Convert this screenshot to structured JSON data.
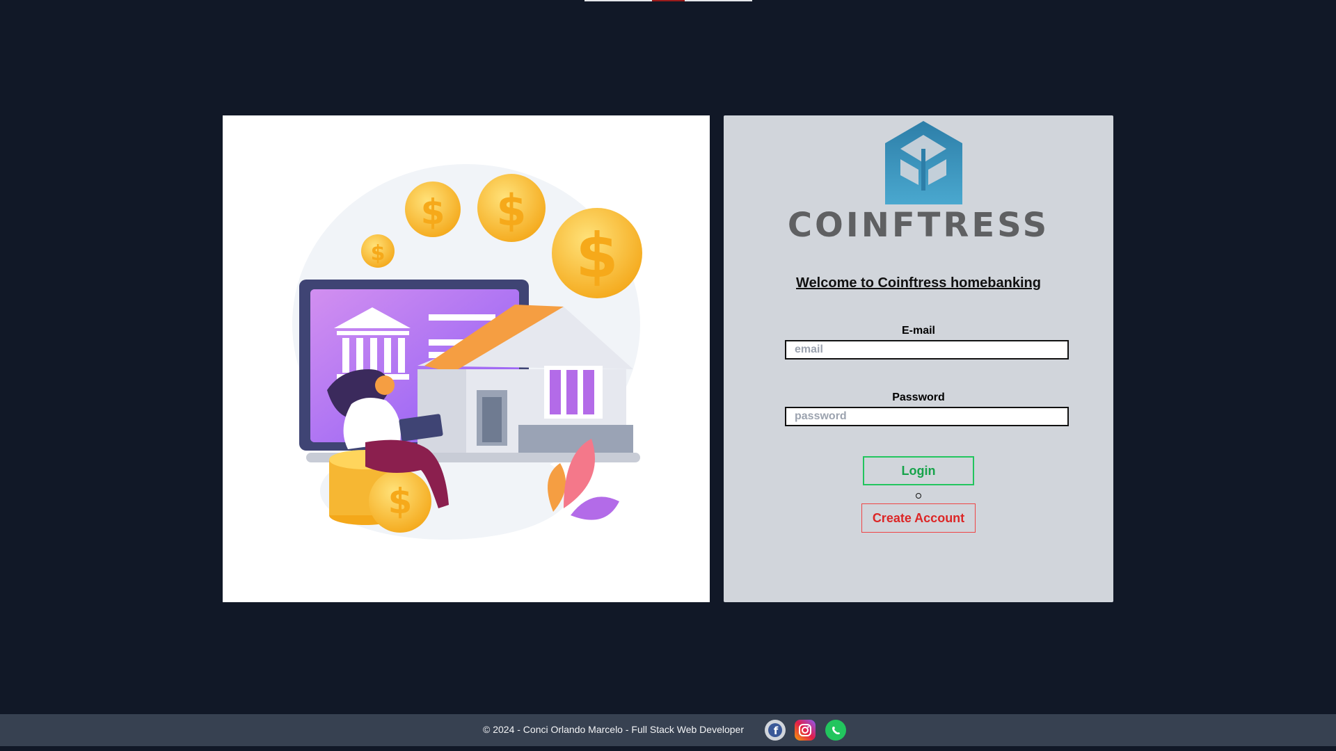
{
  "brand": {
    "logo_text": "COINFTRESS",
    "welcome": "Welcome to Coinftress homebanking"
  },
  "form": {
    "email_label": "E-mail",
    "email_placeholder": "email",
    "password_label": "Password",
    "password_placeholder": "password",
    "login_label": "Login",
    "create_account_label": "Create Account"
  },
  "footer": {
    "text": "© 2024 - Conci Orlando Marcelo - Full Stack Web Developer",
    "social": [
      "facebook-icon",
      "instagram-icon",
      "whatsapp-icon"
    ]
  },
  "colors": {
    "page_bg": "#111827",
    "panel_bg": "#d1d5db",
    "login_accent": "#22c55e",
    "create_accent": "#ef4444",
    "footer_bg": "#374151"
  }
}
